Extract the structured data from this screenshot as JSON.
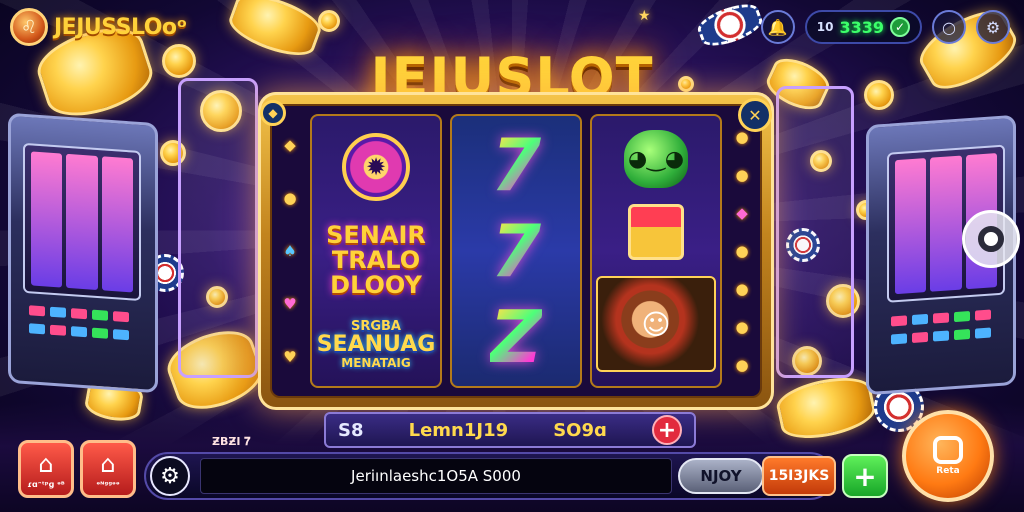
{
  "brand": {
    "logo_icon": "lion-face-icon",
    "name": "JEJUSSLOoᵒ"
  },
  "topbar": {
    "bell_icon": "bell-icon",
    "balance_small": "10",
    "balance_value": "3339",
    "balance_icon": "check-circle-icon",
    "chat_icon": "chat-bubble-icon",
    "settings_icon": "gear-icon"
  },
  "title": "JEJUSLOT",
  "reels": [
    {
      "symbols": [
        {
          "kind": "badge",
          "icon": "gear-medallion-icon"
        },
        {
          "kind": "text",
          "lines": [
            "SENAIR",
            "TRALO",
            "DLOOY"
          ]
        },
        {
          "kind": "text",
          "lines": [
            "SRGBA",
            "SEANUAG",
            "MENATAIG"
          ]
        }
      ]
    },
    {
      "symbols": [
        {
          "kind": "seven",
          "text": "7"
        },
        {
          "kind": "seven",
          "text": "7"
        },
        {
          "kind": "seven",
          "text": "Z"
        }
      ]
    },
    {
      "symbols": [
        {
          "kind": "monster",
          "icon": "green-monster-icon"
        },
        {
          "kind": "gift",
          "icon": "gift-coin-icon"
        },
        {
          "kind": "portrait",
          "icon": "smiling-man-icon"
        }
      ]
    }
  ],
  "frame": {
    "top_left_icon": "gem-icon",
    "top_right_icon": "close-icon",
    "left_symbols": [
      "coin-icon",
      "spade-icon",
      "heart-icon",
      "heart-icon"
    ],
    "right_symbols": [
      "coin-icon",
      "coin-icon",
      "diamond-icon",
      "coin-icon",
      "coin-icon",
      "coin-icon",
      "coin-icon"
    ]
  },
  "info_strip": {
    "left": "S8",
    "center": "Lemn1J19",
    "right": "SO9ɑ",
    "plus_icon": "plus-icon"
  },
  "bottom": {
    "small_label": "ƵBƵI 𝟕",
    "home_buttons": [
      {
        "icon": "home-icon",
        "label": "ɾɑᵔᵗᵖɡ ᵊᴮ"
      },
      {
        "icon": "home-icon",
        "label": "ᵊᴺᵍᵍᵊᵊ"
      }
    ],
    "settings_icon": "settings-icon",
    "input_text": "Jeriınlaeshc1O5A S000",
    "nuy_button": "NJOY",
    "amount_button": "15I3JKS",
    "plus_icon": "plus-icon",
    "spin_icon": "square-outline-icon",
    "spin_label": "Reta",
    "joystick_icon": "target-icon"
  },
  "colors": {
    "gold": "#ffd23a",
    "accent_orange": "#ff7a13",
    "accent_green": "#35e35a",
    "accent_red": "#e22a3e",
    "bg_purple": "#2a1260"
  }
}
